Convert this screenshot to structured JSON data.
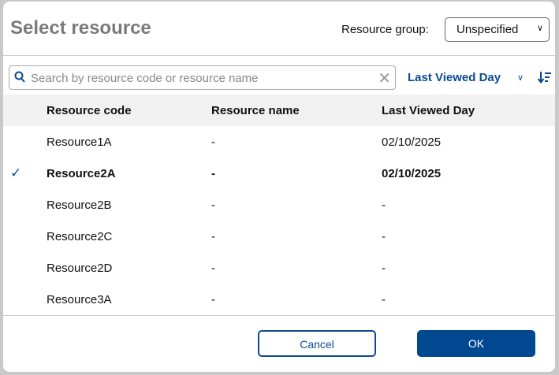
{
  "dialog": {
    "title": "Select resource",
    "resource_group_label": "Resource group:",
    "resource_group_value": "Unspecified"
  },
  "search": {
    "placeholder": "Search by resource code or resource name",
    "value": ""
  },
  "sort": {
    "field": "Last Viewed Day"
  },
  "table": {
    "headers": [
      "Resource code",
      "Resource name",
      "Last Viewed Day"
    ],
    "rows": [
      {
        "code": "Resource1A",
        "name": "-",
        "last_viewed": "02/10/2025",
        "selected": false
      },
      {
        "code": "Resource2A",
        "name": "-",
        "last_viewed": "02/10/2025",
        "selected": true
      },
      {
        "code": "Resource2B",
        "name": "-",
        "last_viewed": "-",
        "selected": false
      },
      {
        "code": "Resource2C",
        "name": "-",
        "last_viewed": "-",
        "selected": false
      },
      {
        "code": "Resource2D",
        "name": "-",
        "last_viewed": "-",
        "selected": false
      },
      {
        "code": "Resource3A",
        "name": "-",
        "last_viewed": "-",
        "selected": false
      }
    ],
    "check_mark": "✓"
  },
  "footer": {
    "cancel": "Cancel",
    "ok": "OK"
  },
  "colors": {
    "accent": "#004890"
  }
}
